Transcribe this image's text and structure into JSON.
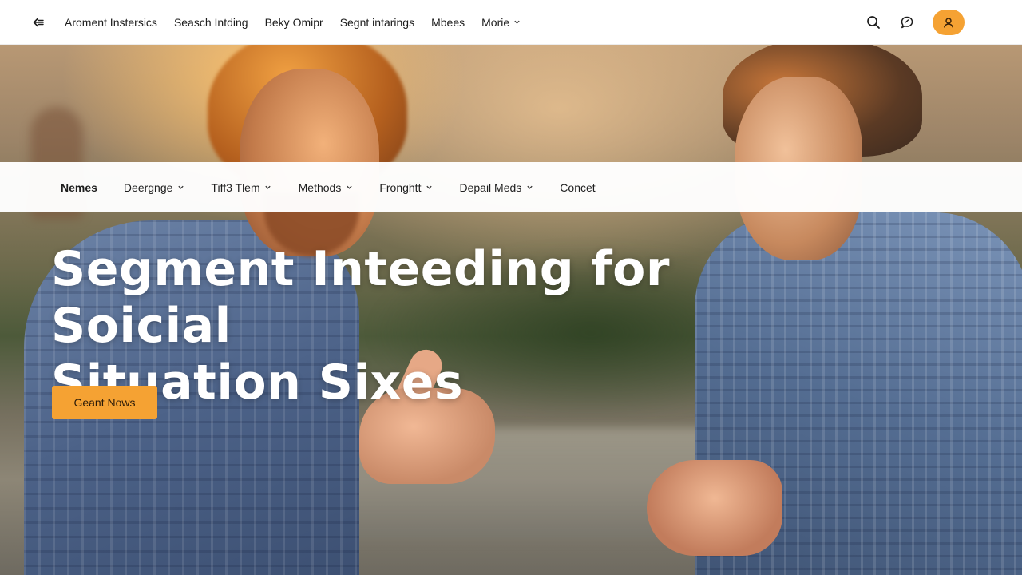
{
  "topbar": {
    "nav": [
      {
        "label": "Aroment Instersics"
      },
      {
        "label": "Seasch Intding"
      },
      {
        "label": "Beky Omipr"
      },
      {
        "label": "Segnt intarings"
      },
      {
        "label": "Mbees"
      },
      {
        "label": "Morie",
        "has_dropdown": true
      }
    ],
    "icons": {
      "back": "arrow-left-icon",
      "search": "search-icon",
      "chat": "chat-bubble-icon",
      "account": "user-icon"
    },
    "accent_color": "#f5a233"
  },
  "subnav": {
    "items": [
      {
        "label": "Nemes",
        "active": true
      },
      {
        "label": "Deergnge",
        "has_dropdown": true
      },
      {
        "label": "Tiff3 Tlem",
        "has_dropdown": true
      },
      {
        "label": "Methods",
        "has_dropdown": true
      },
      {
        "label": "Fronghtt",
        "has_dropdown": true
      },
      {
        "label": "Depail Meds",
        "has_dropdown": true
      },
      {
        "label": "Concet"
      }
    ]
  },
  "hero": {
    "title_line1": "Segment Inteeding for Soicial",
    "title_line2": "Situation Sixes",
    "cta_label": "Geant Nows",
    "cta_color": "#f5a233"
  }
}
